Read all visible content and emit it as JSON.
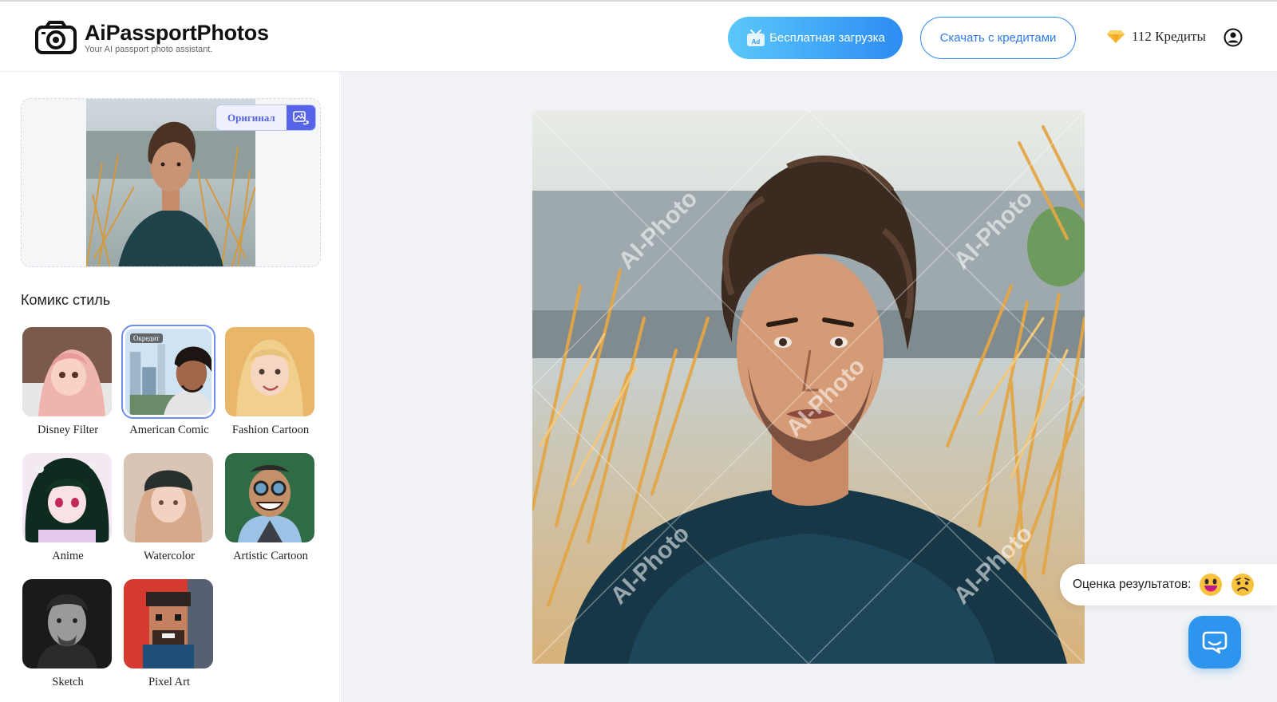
{
  "header": {
    "logo_title": "AiPassportPhotos",
    "logo_subtitle": "Your AI passport photo assistant.",
    "free_download_label": "Бесплатная загрузка",
    "credits_download_label": "Скачать с кредитами",
    "credits_text": "112 Кредиты"
  },
  "sidebar": {
    "original_label": "Оригинал",
    "section_title": "Комикс стиль",
    "styles": [
      {
        "label": "Disney Filter",
        "selected": false
      },
      {
        "label": "American Comic",
        "selected": true,
        "badge": "Окредит"
      },
      {
        "label": "Fashion Cartoon",
        "selected": false
      },
      {
        "label": "Anime",
        "selected": false
      },
      {
        "label": "Watercolor",
        "selected": false
      },
      {
        "label": "Artistic Cartoon",
        "selected": false
      },
      {
        "label": "Sketch",
        "selected": false
      },
      {
        "label": "Pixel Art",
        "selected": false
      }
    ]
  },
  "main": {
    "watermark": "AI-Photo",
    "rating_label": "Оценка результатов:"
  },
  "colors": {
    "accent": "#2f8cf3",
    "free_button_gradient_start": "#5ac8fb",
    "free_button_gradient_end": "#2c8cf4",
    "main_bg": "#f1f2f5",
    "original_accent": "#5564e8"
  },
  "icons": [
    "camera-logo-icon",
    "tv-ad-icon",
    "gem-icon",
    "user-icon",
    "image-swap-icon",
    "happy-emoji-icon",
    "sad-emoji-icon",
    "chat-icon"
  ]
}
